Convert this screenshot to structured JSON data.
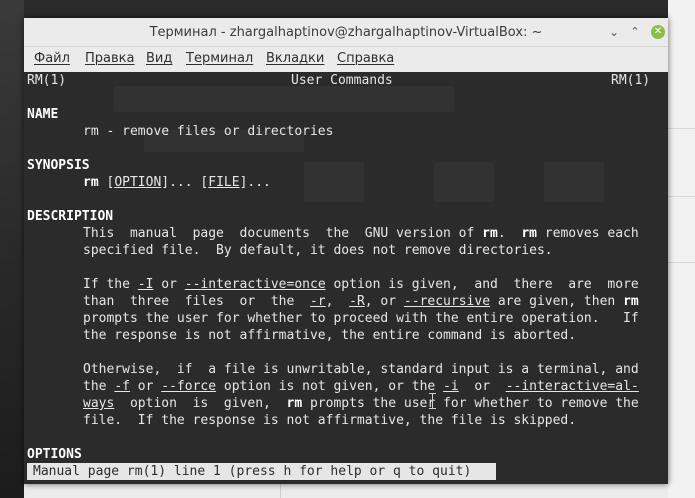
{
  "window": {
    "title": "Терминал - zhargalhaptinov@zhargalhaptinov-VirtualBox: ~",
    "minimize_glyph": "⌄",
    "maximize_glyph": "⌃",
    "close_glyph": "✕"
  },
  "menu": [
    {
      "label": "Файл"
    },
    {
      "label": "Правка"
    },
    {
      "label": "Вид"
    },
    {
      "label": "Терминал"
    },
    {
      "label": "Вкладки"
    },
    {
      "label": "Справка"
    }
  ],
  "man": {
    "header_left": "RM(1)",
    "header_center": "User Commands",
    "header_right": "RM(1)",
    "name_heading": "NAME",
    "name_text": "rm - remove files or directories",
    "synopsis_heading": "SYNOPSIS",
    "synopsis_cmd": "rm",
    "synopsis_option": "OPTION",
    "synopsis_file": "FILE",
    "description_heading": "DESCRIPTION",
    "d1_a": "This  manual  page  documents  the  GNU version of ",
    "d1_rm1": "rm",
    "d1_b": ".  ",
    "d1_rm2": "rm",
    "d1_c": " removes each",
    "d2": "specified file.  By default, it does not remove directories.",
    "p2_l1_a": "If the ",
    "p2_l1_opt1": "-I",
    "p2_l1_b": " or ",
    "p2_l1_opt2": "--interactive=once",
    "p2_l1_c": " option is given,  and  there  are  more",
    "p2_l2_a": "than  three  files  or  the  ",
    "p2_l2_opt1": "-r",
    "p2_l2_b": ",  ",
    "p2_l2_opt2": "-R",
    "p2_l2_c": ", or ",
    "p2_l2_opt3": "--recursive",
    "p2_l2_d": " are given, then ",
    "p2_l2_rm": "rm",
    "p2_l3": "prompts the user for whether to proceed with the entire operation.   If",
    "p2_l4": "the response is not affirmative, the entire command is aborted.",
    "p3_l1": "Otherwise,  if  a file is unwritable, standard input is a terminal, and",
    "p3_l2_a": "the ",
    "p3_l2_opt1": "-f",
    "p3_l2_b": " or ",
    "p3_l2_opt2": "--force",
    "p3_l2_c": " option is not given, or the ",
    "p3_l2_opt3": "-i",
    "p3_l2_d": "  or  ",
    "p3_l2_opt4": "--interactive=al‐",
    "p3_l3_opt": "ways",
    "p3_l3_a": "  option  is  given,  ",
    "p3_l3_rm": "rm",
    "p3_l3_b": " prompts the user for whether to remove the",
    "p3_l4": "file.  If the response is not affirmative, the file is skipped.",
    "options_heading": "OPTIONS"
  },
  "status": {
    "text": "Manual page rm(1) line 1 (press h for help or q to quit)"
  }
}
